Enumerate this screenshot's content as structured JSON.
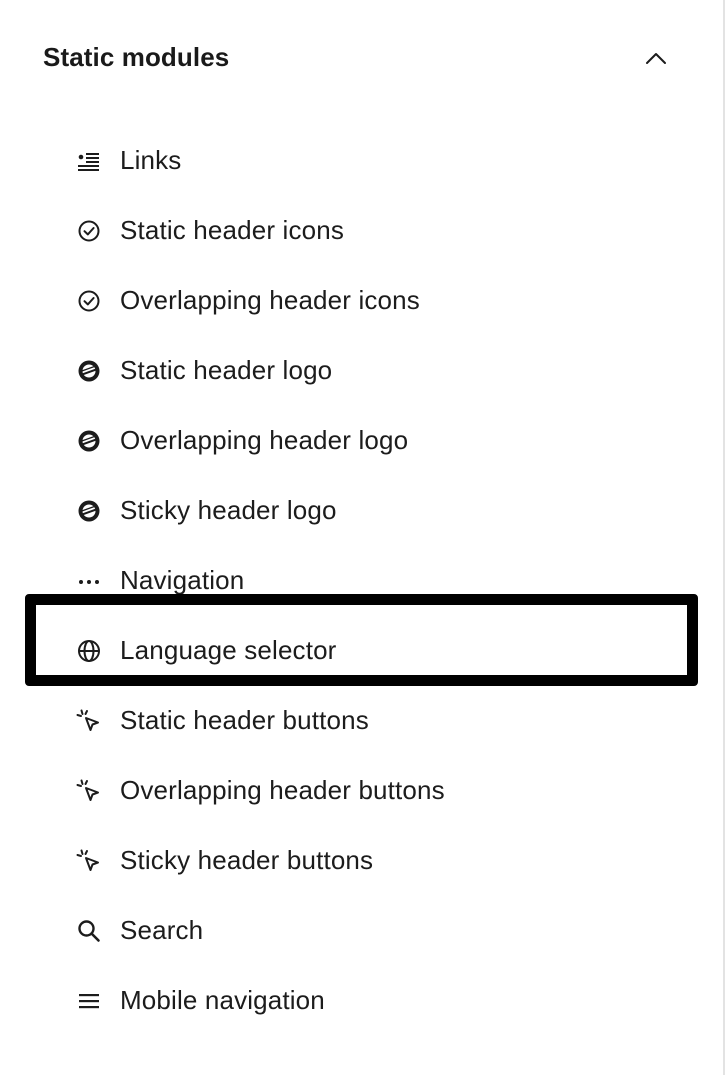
{
  "section": {
    "title": "Static modules",
    "expanded": true,
    "toggle_icon": "chevron-up-icon"
  },
  "items": [
    {
      "label": "Links",
      "icon": "link-list-icon",
      "highlighted": false
    },
    {
      "label": "Static header icons",
      "icon": "check-circle-icon",
      "highlighted": false
    },
    {
      "label": "Overlapping header icons",
      "icon": "check-circle-icon",
      "highlighted": false
    },
    {
      "label": "Static header logo",
      "icon": "logo-icon",
      "highlighted": false
    },
    {
      "label": "Overlapping header logo",
      "icon": "logo-icon",
      "highlighted": false
    },
    {
      "label": "Sticky header logo",
      "icon": "logo-icon",
      "highlighted": false
    },
    {
      "label": "Navigation",
      "icon": "ellipsis-icon",
      "highlighted": false
    },
    {
      "label": "Language selector",
      "icon": "globe-icon",
      "highlighted": true
    },
    {
      "label": "Static header buttons",
      "icon": "cursor-click-icon",
      "highlighted": false
    },
    {
      "label": "Overlapping header buttons",
      "icon": "cursor-click-icon",
      "highlighted": false
    },
    {
      "label": "Sticky header buttons",
      "icon": "cursor-click-icon",
      "highlighted": false
    },
    {
      "label": "Search",
      "icon": "search-icon",
      "highlighted": false
    },
    {
      "label": "Mobile navigation",
      "icon": "hamburger-menu-icon",
      "highlighted": false
    }
  ],
  "colors": {
    "text": "#1c1c1c",
    "highlight_border": "#000000",
    "background": "#ffffff"
  }
}
